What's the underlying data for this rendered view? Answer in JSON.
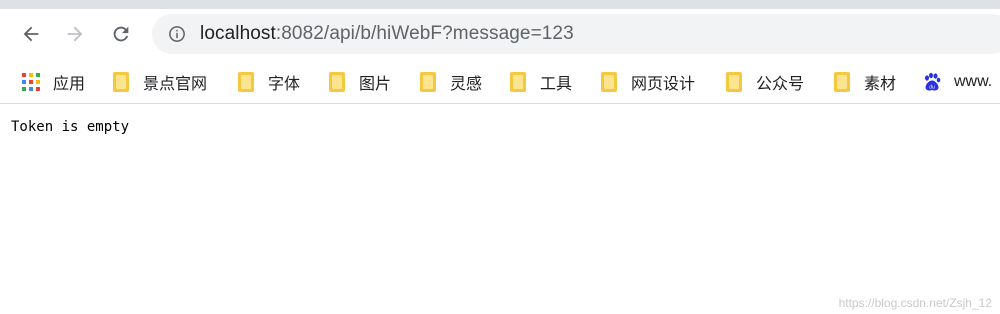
{
  "browser": {
    "url_host": "localhost",
    "url_rest": ":8082/api/b/hiWebF?message=123"
  },
  "bookmarks": [
    {
      "label": "应用",
      "icon": "apps-grid-icon"
    },
    {
      "label": "景点官网",
      "icon": "folder-icon"
    },
    {
      "label": "字体",
      "icon": "folder-icon"
    },
    {
      "label": "图片",
      "icon": "folder-icon"
    },
    {
      "label": "灵感",
      "icon": "folder-icon"
    },
    {
      "label": "工具",
      "icon": "folder-icon"
    },
    {
      "label": "网页设计",
      "icon": "folder-icon"
    },
    {
      "label": "公众号",
      "icon": "folder-icon"
    },
    {
      "label": "素材",
      "icon": "folder-icon"
    },
    {
      "label": "www.",
      "icon": "baidu-paw-icon"
    }
  ],
  "page": {
    "body_text": "Token is empty"
  },
  "watermark": "https://blog.csdn.net/Zsjh_12",
  "colors": {
    "folder": "#f5c842",
    "baidu": "#2932e1",
    "omnibox": "#f1f3f4"
  }
}
